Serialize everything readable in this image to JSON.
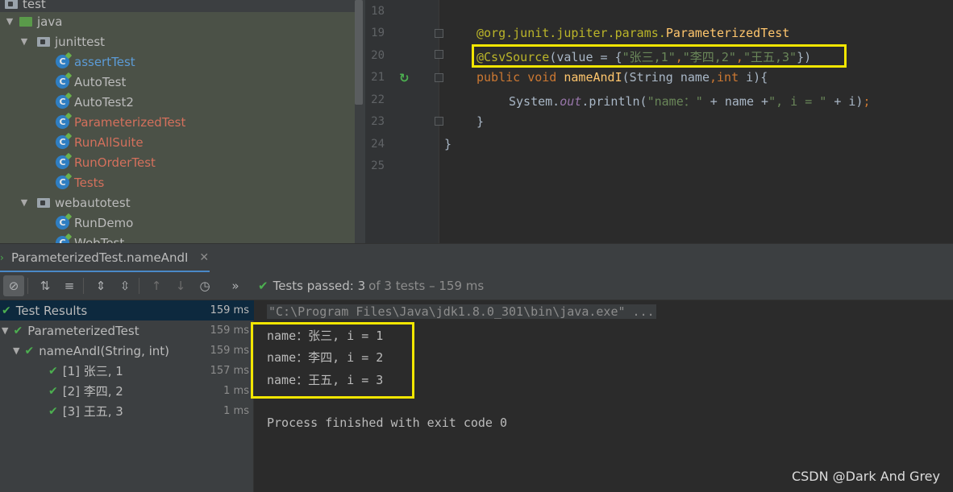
{
  "project_tree": {
    "items": [
      {
        "label": "test",
        "kind": "folder-grey",
        "indent": 0
      },
      {
        "label": "java",
        "kind": "folder-green",
        "indent": 1
      },
      {
        "label": "junittest",
        "kind": "package",
        "indent": 2
      },
      {
        "label": "assertTest",
        "kind": "class-blue",
        "indent": 3
      },
      {
        "label": "AutoTest",
        "kind": "class",
        "indent": 3
      },
      {
        "label": "AutoTest2",
        "kind": "class",
        "indent": 3
      },
      {
        "label": "ParameterizedTest",
        "kind": "class-red",
        "indent": 3
      },
      {
        "label": "RunAllSuite",
        "kind": "class-red",
        "indent": 3
      },
      {
        "label": "RunOrderTest",
        "kind": "class-red",
        "indent": 3
      },
      {
        "label": "Tests",
        "kind": "class-red",
        "indent": 3
      },
      {
        "label": "webautotest",
        "kind": "package",
        "indent": 2
      },
      {
        "label": "RunDemo",
        "kind": "class",
        "indent": 3
      },
      {
        "label": "WebTest",
        "kind": "class",
        "indent": 3
      }
    ]
  },
  "editor": {
    "line_numbers": [
      "18",
      "19",
      "20",
      "21",
      "22",
      "23",
      "24",
      "25"
    ],
    "lines": {
      "l19_annotation": "@org.junit.jupiter.params.",
      "l19_class": "ParameterizedTest",
      "l20_ann": "@CsvSource",
      "l20_open": "(value = {",
      "l20_s1": "\"张三,1\"",
      "l20_c1": ",",
      "l20_s2": "\"李四,2\"",
      "l20_c2": ",",
      "l20_s3": "\"王五,3\"",
      "l20_close": "})",
      "l21_public": "public",
      "l21_void": " void ",
      "l21_name": "nameAndI",
      "l21_params_a": "(String name",
      "l21_comma": ",",
      "l21_int": "int",
      "l21_params_b": " i){",
      "l22_system": "System.",
      "l22_out": "out",
      "l22_println": ".println(",
      "l22_s1": "\"name：\"",
      "l22_plus1": " + name +",
      "l22_s2": "\", i = \"",
      "l22_plus2": " + i)",
      "l22_semi": ";",
      "l23": "}",
      "l24": "}"
    }
  },
  "run_tab": {
    "label": "ParameterizedTest.nameAndI",
    "close": "✕"
  },
  "toolbar": {
    "more": "»",
    "tests_passed": "Tests passed: 3",
    "tests_passed_sub": "of 3 tests – 159 ms"
  },
  "test_tree": {
    "rows": [
      {
        "label": "Test Results",
        "time": "159 ms"
      },
      {
        "label": "ParameterizedTest",
        "time": "159 ms"
      },
      {
        "label": "nameAndI(String, int)",
        "time": "159 ms"
      },
      {
        "label": "[1] 张三, 1",
        "time": "157 ms"
      },
      {
        "label": "[2] 李四, 2",
        "time": "1 ms"
      },
      {
        "label": "[3] 王五, 3",
        "time": "1 ms"
      }
    ]
  },
  "console": {
    "command": "\"C:\\Program Files\\Java\\jdk1.8.0_301\\bin\\java.exe\" ...",
    "output": [
      "name：张三, i = 1",
      "name：李四, i = 2",
      "name：王五, i = 3"
    ],
    "finished": "Process finished with exit code 0"
  },
  "watermark": "CSDN @Dark And Grey",
  "colors": {
    "highlight_box": "#f2e600",
    "pass_green": "#4caf50",
    "string_green": "#6a8759",
    "annotation_yellow": "#bbb529",
    "keyword_orange": "#cc7832"
  }
}
